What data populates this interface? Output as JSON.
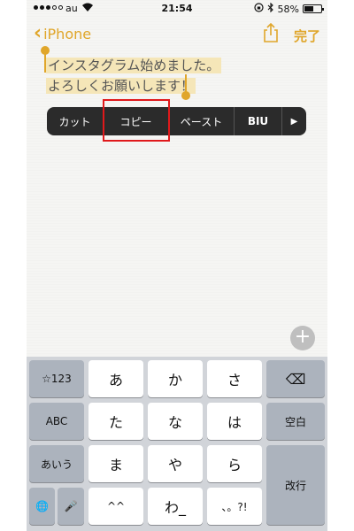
{
  "status": {
    "carrier": "au",
    "time": "21:54",
    "battery": "58%",
    "battery_level": 0.58
  },
  "nav": {
    "back_label": "iPhone",
    "done_label": "完了"
  },
  "note": {
    "line1": "インスタグラム始めました。",
    "line2": "よろしくお願いします！"
  },
  "edit_menu": {
    "cut": "カット",
    "copy": "コピー",
    "paste": "ペースト",
    "format": "BIU",
    "more": "▶"
  },
  "plus_button": "+",
  "keyboard": {
    "row1": [
      "☆123",
      "あ",
      "か",
      "さ",
      "⌫"
    ],
    "row2": [
      "ABC",
      "た",
      "な",
      "は",
      "空白"
    ],
    "row3": [
      "あいう",
      "ま",
      "や",
      "ら",
      "改行"
    ],
    "row4": [
      "🌐",
      "🎤",
      "^^",
      "わ_",
      "、。?!"
    ]
  },
  "colors": {
    "accent": "#e0a62a",
    "highlight": "#f5e6b8",
    "menu_bg": "#2b2b2b",
    "annotation_box": "#e0191b"
  }
}
